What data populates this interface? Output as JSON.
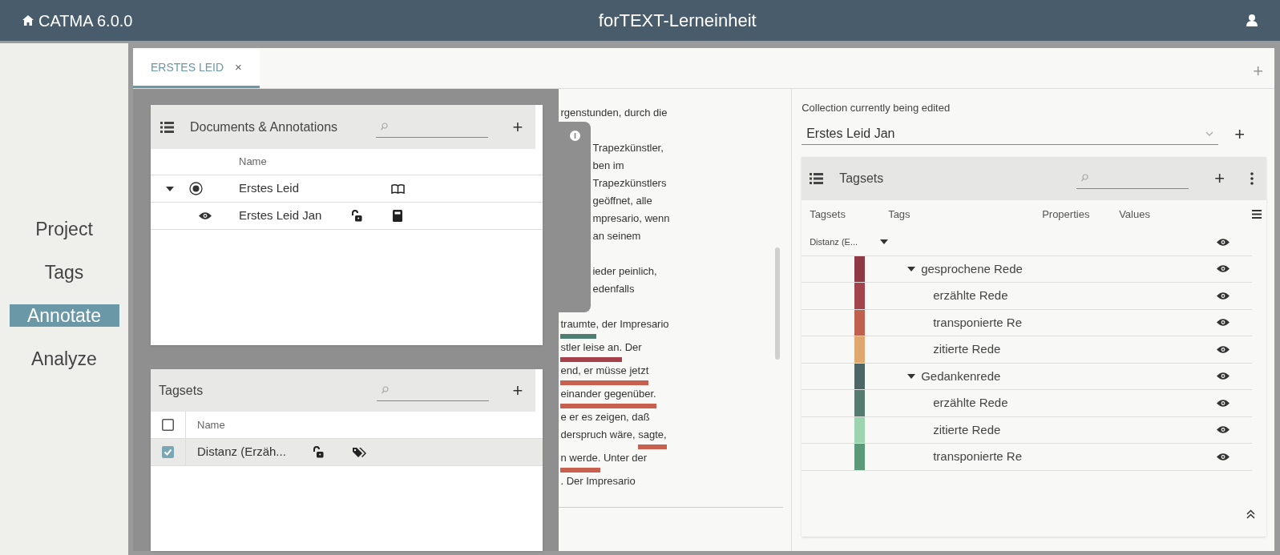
{
  "header": {
    "app_title": "CATMA 6.0.0",
    "project_title": "forTEXT-Lerneinheit"
  },
  "nav": [
    {
      "label": "Project",
      "selected": false
    },
    {
      "label": "Tags",
      "selected": false
    },
    {
      "label": "Annotate",
      "selected": true
    },
    {
      "label": "Analyze",
      "selected": false
    }
  ],
  "tabs": [
    {
      "label": "ERSTES LEID",
      "close": "×",
      "selected": true
    }
  ],
  "tab_add": "+",
  "documents_panel": {
    "title": "Documents & Annotations",
    "add": "+",
    "column": "Name",
    "rows": [
      {
        "name": "Erstes Leid",
        "expanded": true,
        "selected": true,
        "children": [
          {
            "name": "Erstes Leid Jan",
            "visible": true,
            "locked": false
          }
        ]
      }
    ]
  },
  "tagsets_panel": {
    "title": "Tagsets",
    "add": "+",
    "column": "Name",
    "all_checked": false,
    "rows": [
      {
        "name": "Distanz (Erzäh...",
        "checked": true,
        "selected": true,
        "locked": false
      }
    ]
  },
  "text": [
    [
      [
        {
          "text": "rgenstunden, durch die"
        }
      ]
    ],
    [
      [
        {
          "text": "Trapezkünstler,"
        }
      ],
      [
        {
          "text": "ben im"
        }
      ],
      [
        {
          "text": "Trapezkünstlers"
        }
      ],
      [
        {
          "text": "geöffnet, alle"
        }
      ],
      [
        {
          "text": "mpresario, wenn"
        }
      ],
      [
        {
          "text": "an seinem"
        }
      ]
    ],
    [
      [
        {
          "text": "ieder peinlich,"
        }
      ],
      [
        {
          "text": "edenfalls"
        }
      ]
    ],
    [
      [
        {
          "text": "traumte",
          "color": "#4f7f73"
        },
        {
          "text": ", der Impresario"
        }
      ],
      [
        {
          "text": "stler leise an.",
          "color": "#a6404a"
        },
        {
          "text": " Der"
        }
      ],
      [
        {
          "text": "end, er müsse jetzt",
          "color": "#c8604f"
        }
      ],
      [
        {
          "text": "einander gegenüber.",
          "color": "#c8604f"
        }
      ],
      [
        {
          "text": "e er es zeigen, daß"
        }
      ],
      [
        {
          "text": "derspruch wäre, "
        },
        {
          "text": "sagte,",
          "color": "#c8604f"
        }
      ],
      [
        {
          "text": "n werde.",
          "color": "#c8604f"
        },
        {
          "text": " Unter der"
        }
      ],
      [
        {
          "text": ". Der Impresario"
        }
      ]
    ]
  ],
  "annotation_panel": {
    "collection_label": "Collection currently being edited",
    "collection": "Erstes Leid Jan",
    "add": "+",
    "tagsets": {
      "title": "Tagsets",
      "add": "+",
      "columns": [
        "Tagsets",
        "Tags",
        "Properties",
        "Values"
      ],
      "rows": [
        {
          "tagset": "Distanz (E...",
          "expanded": true,
          "visible": true,
          "tags": [
            {
              "name": "gesprochene Rede",
              "color": "#8e3a44",
              "expanded": true,
              "visible": true,
              "children": [
                {
                  "name": "erzählte Rede",
                  "color": "#a3434c",
                  "visible": true
                },
                {
                  "name": "transponierte Re",
                  "color": "#c0604f",
                  "visible": true
                },
                {
                  "name": "zitierte Rede",
                  "color": "#e0a86e",
                  "visible": true
                }
              ]
            },
            {
              "name": "Gedankenrede",
              "color": "#4e6566",
              "expanded": true,
              "visible": true,
              "children": [
                {
                  "name": "erzählte Rede",
                  "color": "#557a70",
                  "visible": true
                },
                {
                  "name": "zitierte Rede",
                  "color": "#9dd4b0",
                  "visible": true
                },
                {
                  "name": "transponierte Re",
                  "color": "#5a9a78",
                  "visible": true
                }
              ]
            }
          ]
        }
      ]
    }
  }
}
